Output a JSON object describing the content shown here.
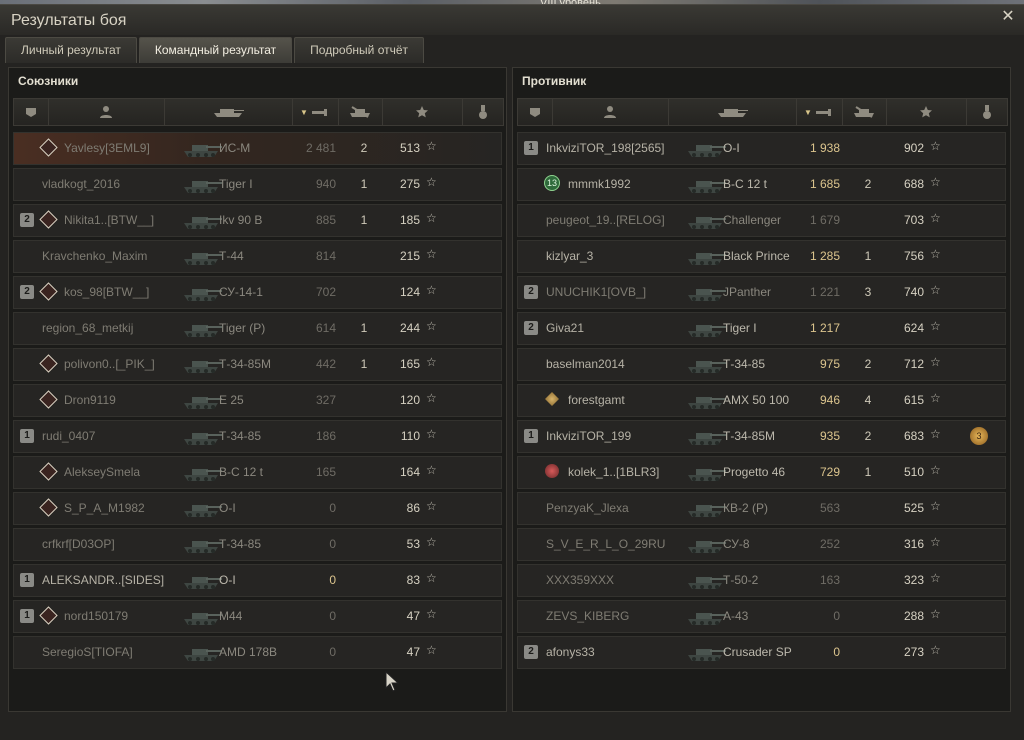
{
  "top_strip": {
    "text": "VIII уровень"
  },
  "window": {
    "title": "Результаты боя"
  },
  "tabs": [
    {
      "label": "Личный результат",
      "active": false
    },
    {
      "label": "Командный результат",
      "active": true
    },
    {
      "label": "Подробный отчёт",
      "active": false
    }
  ],
  "star_symbol": "☆",
  "allies": {
    "title": "Союзники",
    "rows": [
      {
        "platoon": "",
        "rank": "diamond",
        "name": "Yavlesy[3EML9]",
        "tank": "ИС-М",
        "damage": "2 481",
        "kills": "2",
        "xp": "513",
        "alive": false,
        "me": true
      },
      {
        "platoon": "",
        "rank": "",
        "name": "vladkogt_2016",
        "tank": "Tiger I",
        "damage": "940",
        "kills": "1",
        "xp": "275",
        "alive": false
      },
      {
        "platoon": "2",
        "rank": "diamond",
        "name": "Nikita1..[BTW__]",
        "tank": "Ikv 90 B",
        "damage": "885",
        "kills": "1",
        "xp": "185",
        "alive": false
      },
      {
        "platoon": "",
        "rank": "",
        "name": "Kravchenko_Maxim",
        "tank": "Т-44",
        "damage": "814",
        "kills": "",
        "xp": "215",
        "alive": false
      },
      {
        "platoon": "2",
        "rank": "diamond",
        "name": "kos_98[BTW__]",
        "tank": "СУ-14-1",
        "damage": "702",
        "kills": "",
        "xp": "124",
        "alive": false
      },
      {
        "platoon": "",
        "rank": "",
        "name": "region_68_metkij",
        "tank": "Tiger (P)",
        "damage": "614",
        "kills": "1",
        "xp": "244",
        "alive": false
      },
      {
        "platoon": "",
        "rank": "diamond",
        "name": "polivon0..[_PIK_]",
        "tank": "Т-34-85М",
        "damage": "442",
        "kills": "1",
        "xp": "165",
        "alive": false
      },
      {
        "platoon": "",
        "rank": "diamond",
        "name": "Dron9119",
        "tank": "E 25",
        "damage": "327",
        "kills": "",
        "xp": "120",
        "alive": false
      },
      {
        "platoon": "1",
        "rank": "",
        "name": "rudi_0407",
        "tank": "Т-34-85",
        "damage": "186",
        "kills": "",
        "xp": "110",
        "alive": false
      },
      {
        "platoon": "",
        "rank": "diamond",
        "name": "AlekseySmela",
        "tank": "В-С 12 t",
        "damage": "165",
        "kills": "",
        "xp": "164",
        "alive": false
      },
      {
        "platoon": "",
        "rank": "diamond",
        "name": "S_P_A_M1982",
        "tank": "О-I",
        "damage": "0",
        "kills": "",
        "xp": "86",
        "alive": false
      },
      {
        "platoon": "",
        "rank": "",
        "name": "crfkrf[D03OP]",
        "tank": "Т-34-85",
        "damage": "0",
        "kills": "",
        "xp": "53",
        "alive": false
      },
      {
        "platoon": "1",
        "rank": "",
        "name": "ALEKSANDR..[SIDES]",
        "tank": "О-I",
        "damage": "0",
        "kills": "",
        "xp": "83",
        "alive": true
      },
      {
        "platoon": "1",
        "rank": "diamond",
        "name": "nord150179",
        "tank": "M44",
        "damage": "0",
        "kills": "",
        "xp": "47",
        "alive": false
      },
      {
        "platoon": "",
        "rank": "",
        "name": "SeregioS[TIOFA]",
        "tank": "AMD 178B",
        "damage": "0",
        "kills": "",
        "xp": "47",
        "alive": false
      }
    ]
  },
  "enemies": {
    "title": "Противник",
    "rows": [
      {
        "platoon": "1",
        "rank": "",
        "name": "InkviziTOR_198[2565]",
        "tank": "О-I",
        "damage": "1 938",
        "kills": "",
        "xp": "902",
        "alive": true
      },
      {
        "platoon": "",
        "rank": "badge",
        "rank_text": "13",
        "name": "mmmk1992",
        "tank": "В-С 12 t",
        "damage": "1 685",
        "kills": "2",
        "xp": "688",
        "alive": true
      },
      {
        "platoon": "",
        "rank": "",
        "name": "peugeot_19..[RELOG]",
        "tank": "Challenger",
        "damage": "1 679",
        "kills": "",
        "xp": "703",
        "alive": false
      },
      {
        "platoon": "",
        "rank": "",
        "name": "kizlyar_3",
        "tank": "Black Prince",
        "damage": "1 285",
        "kills": "1",
        "xp": "756",
        "alive": true
      },
      {
        "platoon": "2",
        "rank": "",
        "name": "UNUCHIK1[OVB_]",
        "tank": "JPanther",
        "damage": "1 221",
        "kills": "3",
        "xp": "740",
        "alive": false
      },
      {
        "platoon": "2",
        "rank": "",
        "name": "Giva21",
        "tank": "Tiger I",
        "damage": "1 217",
        "kills": "",
        "xp": "624",
        "alive": true
      },
      {
        "platoon": "",
        "rank": "",
        "name": "baselman2014",
        "tank": "Т-34-85",
        "damage": "975",
        "kills": "2",
        "xp": "712",
        "alive": true
      },
      {
        "platoon": "",
        "rank": "medal",
        "name": "forestgamt",
        "tank": "AMX 50 100",
        "damage": "946",
        "kills": "4",
        "xp": "615",
        "alive": true
      },
      {
        "platoon": "1",
        "rank": "",
        "name": "InkviziTOR_199",
        "tank": "Т-34-85М",
        "damage": "935",
        "kills": "2",
        "xp": "683",
        "alive": true,
        "achievement": "3"
      },
      {
        "platoon": "",
        "rank": "skull",
        "name": "kolek_1..[1BLR3]",
        "tank": "Progetto 46",
        "damage": "729",
        "kills": "1",
        "xp": "510",
        "alive": true
      },
      {
        "platoon": "",
        "rank": "",
        "name": "PenzyaK_Jlexa",
        "tank": "КВ-2 (Р)",
        "damage": "563",
        "kills": "",
        "xp": "525",
        "alive": false
      },
      {
        "platoon": "",
        "rank": "",
        "name": "S_V_E_R_L_O_29RU",
        "tank": "СУ-8",
        "damage": "252",
        "kills": "",
        "xp": "316",
        "alive": false
      },
      {
        "platoon": "",
        "rank": "",
        "name": "XXX359XXX",
        "tank": "Т-50-2",
        "damage": "163",
        "kills": "",
        "xp": "323",
        "alive": false
      },
      {
        "platoon": "",
        "rank": "",
        "name": "ZEVS_KIBERG",
        "tank": "А-43",
        "damage": "0",
        "kills": "",
        "xp": "288",
        "alive": false
      },
      {
        "platoon": "2",
        "rank": "",
        "name": "afonys33",
        "tank": "Crusader SP",
        "damage": "0",
        "kills": "",
        "xp": "273",
        "alive": true
      }
    ]
  },
  "columns": [
    {
      "icon": "platoon-column-icon"
    },
    {
      "icon": "player-column-icon"
    },
    {
      "icon": "tank-column-icon"
    },
    {
      "icon": "damage-column-icon",
      "sorted": true
    },
    {
      "icon": "kills-column-icon"
    },
    {
      "icon": "xp-column-icon"
    },
    {
      "icon": "achievements-column-icon"
    }
  ]
}
